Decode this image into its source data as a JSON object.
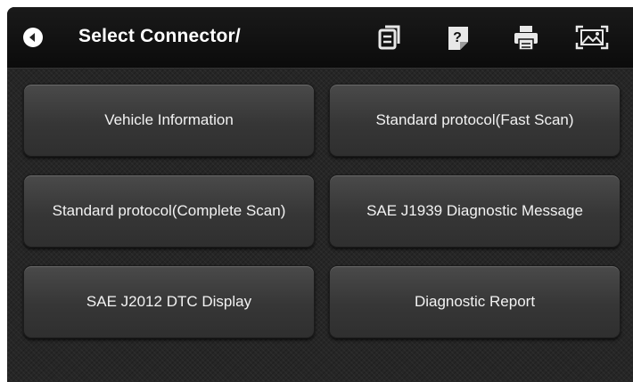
{
  "header": {
    "title": "Select Connector/",
    "back_icon": "back-arrow-icon",
    "tools": [
      {
        "name": "copy-icon"
      },
      {
        "name": "help-icon"
      },
      {
        "name": "print-icon"
      },
      {
        "name": "screenshot-icon"
      }
    ]
  },
  "menu": {
    "items": [
      {
        "label": "Vehicle Information"
      },
      {
        "label": "Standard protocol(Fast Scan)"
      },
      {
        "label": "Standard protocol(Complete Scan)"
      },
      {
        "label": "SAE J1939 Diagnostic Message"
      },
      {
        "label": "SAE J2012 DTC Display"
      },
      {
        "label": "Diagnostic Report"
      }
    ]
  },
  "colors": {
    "background": "#262626",
    "titlebar": "#111111",
    "button": "#3e3e3e",
    "text": "#ffffff"
  }
}
